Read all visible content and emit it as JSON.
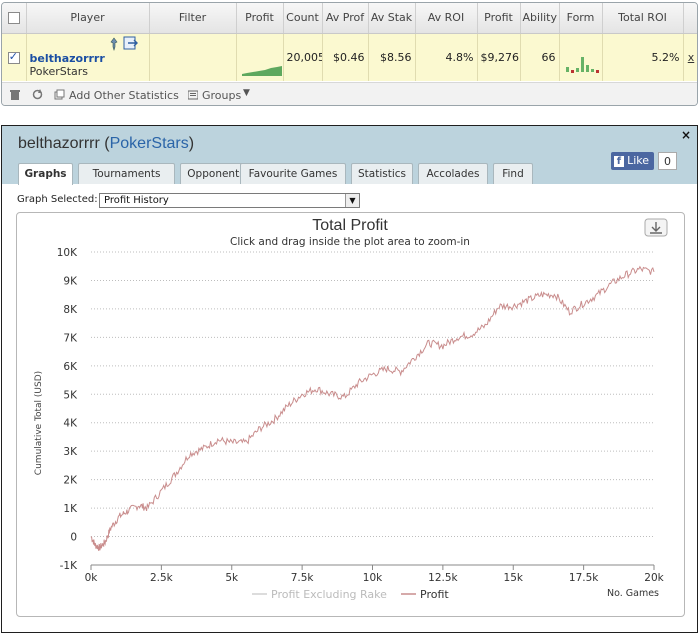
{
  "top_table": {
    "headers": [
      "Player",
      "Filter",
      "Profit",
      "Count",
      "Av Prof",
      "Av Stak",
      "Av ROI",
      "Profit",
      "Ability",
      "Form",
      "Total ROI"
    ],
    "row": {
      "checked": true,
      "player_name": "belthazorrrr",
      "player_site": "PokerStars",
      "count": "20,005",
      "av_profit": "$0.46",
      "av_stake": "$8.56",
      "av_roi": "4.8%",
      "profit": "$9,276",
      "ability": "66",
      "total_roi": "5.2%",
      "remove": "x"
    },
    "toolbar": {
      "add_stats": "Add Other Statistics",
      "groups": "Groups"
    }
  },
  "profile": {
    "player_name": "belthazorrrr",
    "site": "PokerStars",
    "close": "×",
    "facebook": {
      "like": "Like",
      "count": "0"
    },
    "tabs": [
      "Graphs",
      "Tournaments",
      "Opponents",
      "Favourite Games",
      "Statistics",
      "Accolades",
      "Find"
    ],
    "active_tab": "Graphs",
    "graph_selected_label": "Graph Selected:",
    "graph_selected_value": "Profit History"
  },
  "colors": {
    "series_profit": "#c98d8d",
    "series_excluding_rake": "#d0d0d0",
    "axis_text": "#333333",
    "header_bg": "#bcd3dd"
  },
  "chart_data": {
    "type": "line",
    "title": "Total Profit",
    "subtitle": "Click and drag inside the plot area to zoom-in",
    "ylabel": "Cumulative Total (USD)",
    "xlabel": "No. Games",
    "xlim": [
      0,
      20000
    ],
    "ylim": [
      -1000,
      10000
    ],
    "x_ticks": [
      "0k",
      "2.5k",
      "5k",
      "7.5k",
      "10k",
      "12.5k",
      "15k",
      "17.5k",
      "20k"
    ],
    "y_ticks": [
      "-1K",
      "0",
      "1K",
      "2K",
      "3K",
      "4K",
      "5K",
      "6K",
      "7K",
      "8K",
      "9K",
      "10K"
    ],
    "legend": [
      "Profit Excluding Rake",
      "Profit"
    ],
    "series": [
      {
        "name": "Profit",
        "x": [
          0,
          150,
          300,
          500,
          700,
          1000,
          1300,
          1700,
          2000,
          2500,
          3000,
          3500,
          4000,
          4500,
          5000,
          5500,
          6000,
          6500,
          7000,
          7500,
          8000,
          8500,
          9000,
          9500,
          10000,
          10500,
          11000,
          11500,
          12000,
          12500,
          13000,
          13500,
          14000,
          14500,
          15000,
          15500,
          16000,
          16500,
          17000,
          17500,
          18000,
          18500,
          19000,
          19500,
          20000
        ],
        "y": [
          0,
          -300,
          -400,
          -200,
          300,
          700,
          900,
          1100,
          1000,
          1600,
          2200,
          2900,
          3100,
          3400,
          3300,
          3300,
          3800,
          4100,
          4600,
          5000,
          5200,
          5000,
          4900,
          5400,
          5700,
          5900,
          5800,
          6300,
          6800,
          6700,
          7000,
          7100,
          7400,
          8100,
          8100,
          8300,
          8500,
          8500,
          7900,
          8200,
          8500,
          8900,
          9200,
          9400,
          9300
        ]
      }
    ]
  }
}
